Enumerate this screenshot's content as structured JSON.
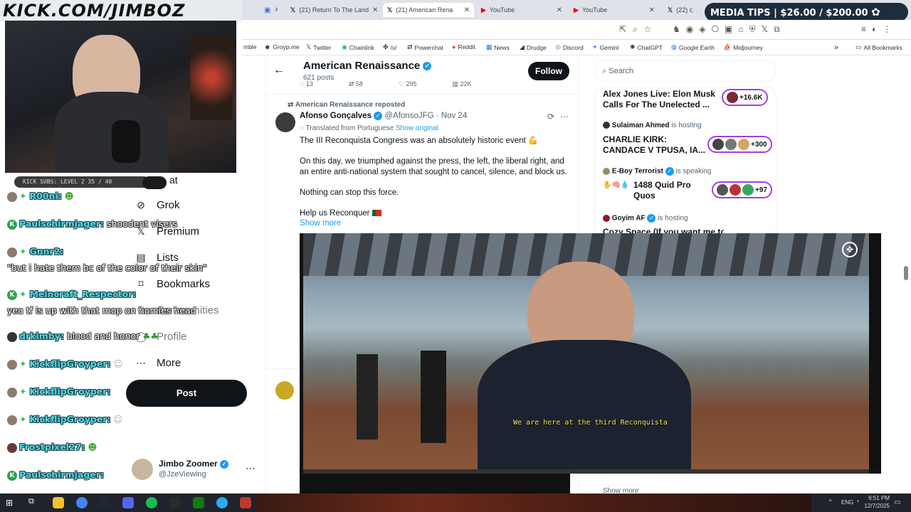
{
  "stream": {
    "url_logo": "KICK.COM/JIMBOZ",
    "subs_goal": "KICK SUBS: LEVEL 2 35 / 40",
    "media_tips": "MEDIA TIPS | $26.00 / $200.00"
  },
  "tabs": [
    {
      "label": "(21) Return To The Land",
      "icon": "x-logo-icon"
    },
    {
      "label": "(21) American Rena",
      "icon": "x-logo-icon",
      "active": true
    },
    {
      "label": "YouTube",
      "icon": "youtube-icon"
    },
    {
      "label": "YouTube",
      "icon": "youtube-icon"
    },
    {
      "label": "(22) c",
      "icon": "x-logo-icon"
    }
  ],
  "bookmarks": [
    {
      "label": "mble"
    },
    {
      "label": "Groyp.me"
    },
    {
      "label": "Twitter"
    },
    {
      "label": "Chainlink"
    },
    {
      "label": "/x/"
    },
    {
      "label": "Powerchat"
    },
    {
      "label": "Reddit"
    },
    {
      "label": "News"
    },
    {
      "label": "Drudge"
    },
    {
      "label": "Discord"
    },
    {
      "label": "Gemini"
    },
    {
      "label": "ChatGPT"
    },
    {
      "label": "Google Earth"
    },
    {
      "label": "Midjourney"
    }
  ],
  "all_bookmarks": "All Bookmarks",
  "header": {
    "title": "American Renaissance",
    "posts": "621 posts",
    "follow": "Follow",
    "prev_stats": [
      "13",
      "58",
      "295",
      "22K"
    ]
  },
  "tweet": {
    "repost": "American Renaissance reposted",
    "author": "Afonso Gonçalves",
    "handle_date": "@AfonsoJFG · Nov 24",
    "translated": "Translated from Portuguese",
    "show_original": "Show original",
    "line1": "The III Reconquista Congress was an absolutely historic event 💪",
    "para2": "On this day, we triumphed against the press, the left, the liberal right, and an entire anti-national system that sought to cancel, silence, and block us.",
    "para3": "Nothing can stop this force.",
    "para4": "Help us Reconquer",
    "show_more": "Show more"
  },
  "video": {
    "subtitle": "We are here at the third Reconquista"
  },
  "search": {
    "placeholder": "Search"
  },
  "spaces": [
    {
      "title": "Alex Jones Live: Elon Musk Calls For The Unelected ...",
      "count": "+16.6K"
    },
    {
      "host": "Sulaiman Ahmed",
      "status": "is hosting",
      "title": "CHARLIE KIRK: CANDACE V TPUSA, IA...",
      "count": "+300"
    },
    {
      "host": "E-Boy Terrorist",
      "status": "is speaking",
      "title": "1488 Quid Pro Quos",
      "count": "+97"
    },
    {
      "host": "Goyim AF",
      "status": "is hosting",
      "title": "Cozy Space (If you want me to"
    }
  ],
  "show_more_right": "Show more",
  "nav": [
    "Grok",
    "Premium",
    "Lists",
    "Bookmarks",
    "Communities",
    "Profile",
    "More"
  ],
  "nav_partial": "at",
  "post_button": "Post",
  "account": {
    "name": "Jimbo Zoomer",
    "handle": "@JzeViewing"
  },
  "chat": [
    {
      "user": "R00ni:",
      "msg": ""
    },
    {
      "user": "Paulschirmjager:",
      "msg": "shoodent visers"
    },
    {
      "user": "Gnnr2:",
      "msg": ""
    },
    {
      "user": "",
      "msg": "\"but i hate them bc of the color of their skin\""
    },
    {
      "user": "Meincraft_Respector:",
      "msg": ""
    },
    {
      "user": "",
      "msg": "yea tf is up with that mop on homies head"
    },
    {
      "user": "drkimby:",
      "msg": "blood and honor"
    },
    {
      "user": "KickflipGroyper:",
      "msg": ""
    },
    {
      "user": "KickflipGroyper:",
      "msg": ""
    },
    {
      "user": "KickflipGroyper:",
      "msg": ""
    },
    {
      "user": "Frostpixel27:",
      "msg": ""
    },
    {
      "user": "Paulschirmjager:",
      "msg": ""
    }
  ],
  "tray": {
    "lang": "ENG",
    "time": "6:51 PM",
    "date": "12/7/2025"
  },
  "colors": {
    "accent": "#1d9bf0",
    "chat_name": "#53d8e7",
    "pill_border": "#a33de0"
  }
}
